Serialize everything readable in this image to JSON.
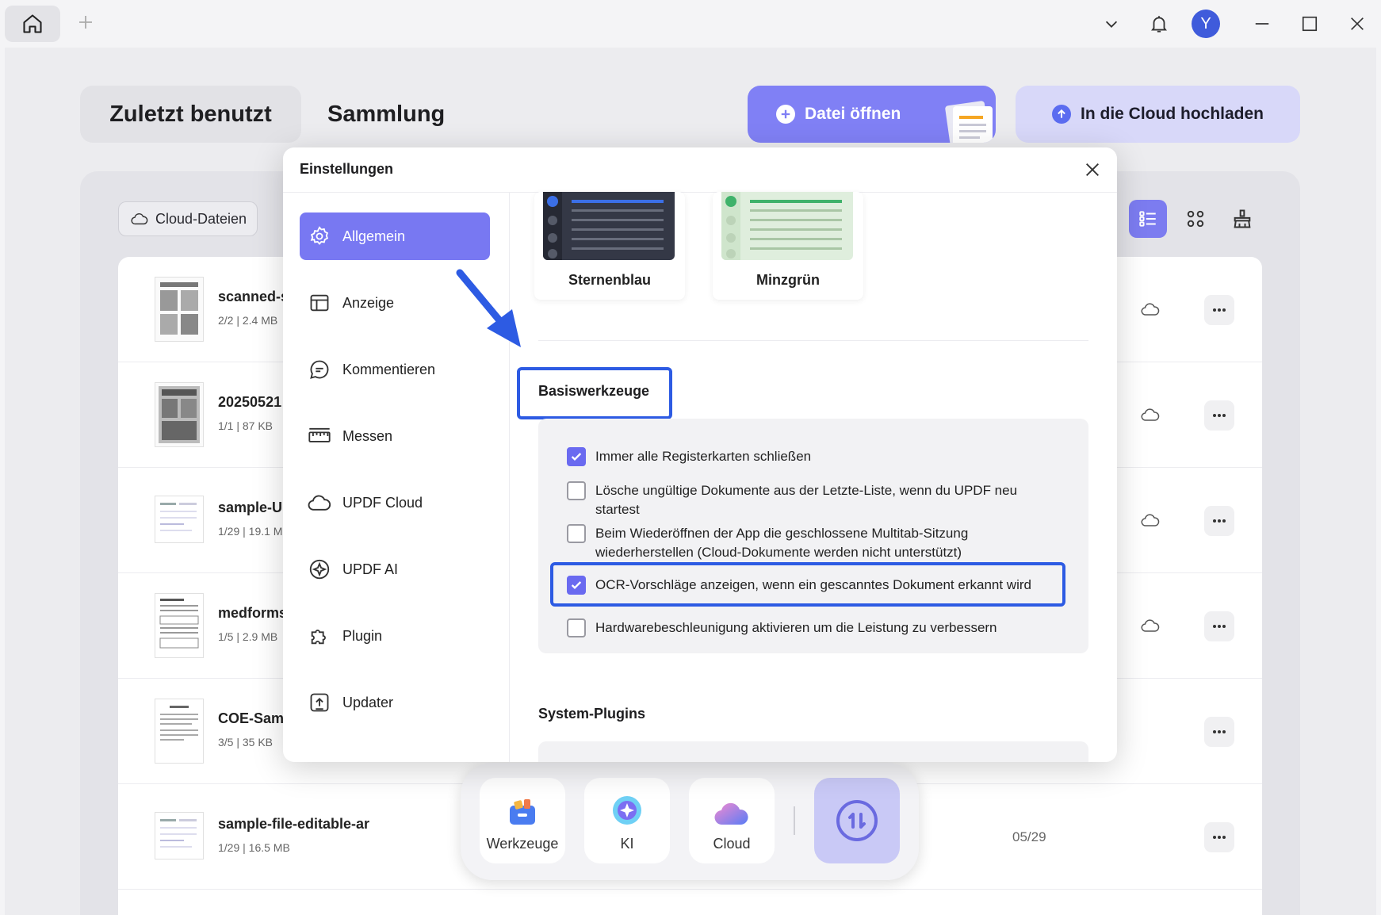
{
  "titlebar": {
    "avatar_letter": "Y",
    "icons": [
      "home-icon",
      "plus-icon",
      "chevron-down-icon",
      "bell-icon",
      "minimize-icon",
      "maximize-icon",
      "close-icon"
    ]
  },
  "home": {
    "tab_recent": "Zuletzt benutzt",
    "tab_collection": "Sammlung",
    "open_file": "Datei öffnen",
    "upload_cloud": "In die Cloud hochladen",
    "cloud_files": "Cloud-Dateien"
  },
  "files": [
    {
      "name": "scanned-s",
      "meta": "2/2 | 2.4 MB",
      "date": ""
    },
    {
      "name": "20250521",
      "meta": "1/1 | 87 KB",
      "date": ""
    },
    {
      "name": "sample-UI",
      "meta": "1/29 | 19.1 M",
      "date": ""
    },
    {
      "name": "medforms",
      "meta": "1/5 | 2.9 MB",
      "date": ""
    },
    {
      "name": "COE-Samp",
      "meta": "3/5 | 35 KB",
      "date": ""
    },
    {
      "name": "sample-file-editable-ar",
      "meta": "1/29 | 16.5 MB",
      "date": "05/29"
    }
  ],
  "dock": {
    "tools": "Werkzeuge",
    "ai": "KI",
    "cloud": "Cloud"
  },
  "settings": {
    "title": "Einstellungen",
    "nav": [
      {
        "label": "Allgemein",
        "icon": "gear-icon"
      },
      {
        "label": "Anzeige",
        "icon": "layout-icon"
      },
      {
        "label": "Kommentieren",
        "icon": "comment-icon"
      },
      {
        "label": "Messen",
        "icon": "ruler-icon"
      },
      {
        "label": "UPDF Cloud",
        "icon": "cloud-icon"
      },
      {
        "label": "UPDF AI",
        "icon": "ai-icon"
      },
      {
        "label": "Plugin",
        "icon": "puzzle-icon"
      },
      {
        "label": "Updater",
        "icon": "update-icon"
      }
    ],
    "themes": [
      {
        "name": "Sternenblau",
        "color": "#3b6fe6"
      },
      {
        "name": "Minzgrün",
        "color": "#3fb26a"
      }
    ],
    "basic_tools_title": "Basiswerkzeuge",
    "options": [
      {
        "label": "Immer alle Registerkarten schließen",
        "checked": true
      },
      {
        "label": "Lösche ungültige Dokumente aus der Letzte-Liste, wenn du UPDF neu startest",
        "checked": false
      },
      {
        "label": "Beim Wiederöffnen der App die geschlossene Multitab-Sitzung wiederherstellen (Cloud-Dokumente werden nicht unterstützt)",
        "checked": false
      },
      {
        "label": "OCR-Vorschläge anzeigen, wenn ein gescanntes Dokument erkannt wird",
        "checked": true
      },
      {
        "label": "Hardwarebeschleunigung aktivieren um die Leistung zu verbessern",
        "checked": false
      }
    ],
    "system_plugins_title": "System-Plugins"
  },
  "colors": {
    "accent": "#7878f2",
    "highlight": "#2d5be3"
  }
}
